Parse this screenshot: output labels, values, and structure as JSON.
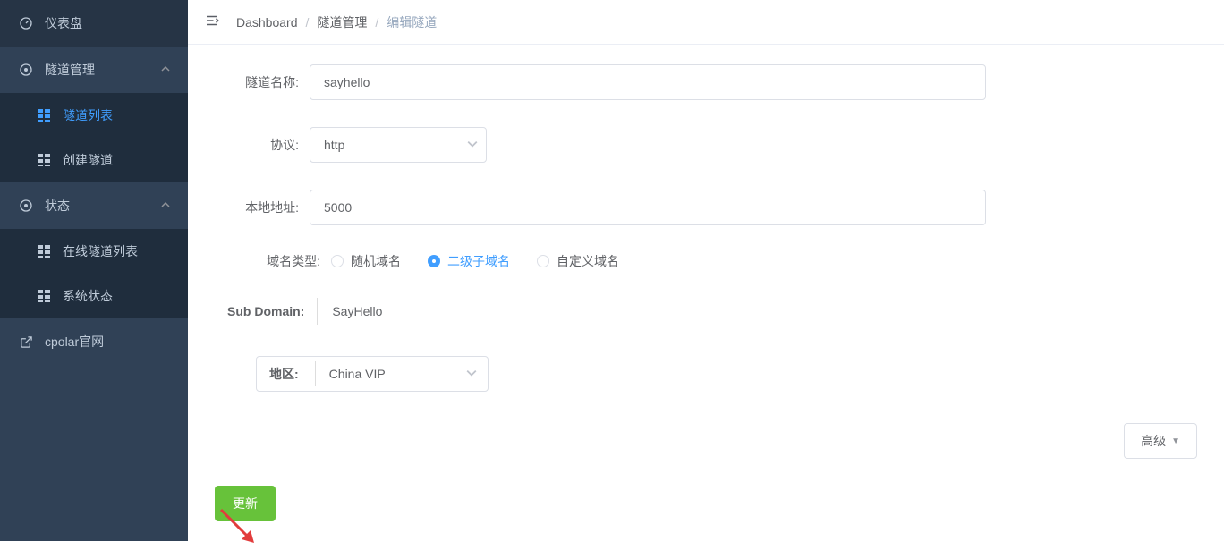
{
  "sidebar": {
    "items": [
      {
        "icon": "gauge",
        "label": "仪表盘"
      },
      {
        "icon": "compass",
        "label": "隧道管理",
        "expanded": true,
        "children": [
          {
            "label": "隧道列表",
            "active": true
          },
          {
            "label": "创建隧道"
          }
        ]
      },
      {
        "icon": "compass",
        "label": "状态",
        "expanded": true,
        "children": [
          {
            "label": "在线隧道列表"
          },
          {
            "label": "系统状态"
          }
        ]
      },
      {
        "icon": "external",
        "label": "cpolar官网"
      }
    ]
  },
  "breadcrumb": {
    "items": [
      "Dashboard",
      "隧道管理",
      "编辑隧道"
    ]
  },
  "form": {
    "tunnel_name_label": "隧道名称:",
    "tunnel_name_value": "sayhello",
    "protocol_label": "协议:",
    "protocol_value": "http",
    "local_addr_label": "本地地址:",
    "local_addr_value": "5000",
    "domain_type_label": "域名类型:",
    "domain_type_options": [
      "随机域名",
      "二级子域名",
      "自定义域名"
    ],
    "domain_type_selected": "二级子域名",
    "subdomain_label": "Sub Domain:",
    "subdomain_value": "SayHello",
    "region_label": "地区:",
    "region_value": "China VIP",
    "advanced_label": "高级",
    "update_label": "更新"
  }
}
